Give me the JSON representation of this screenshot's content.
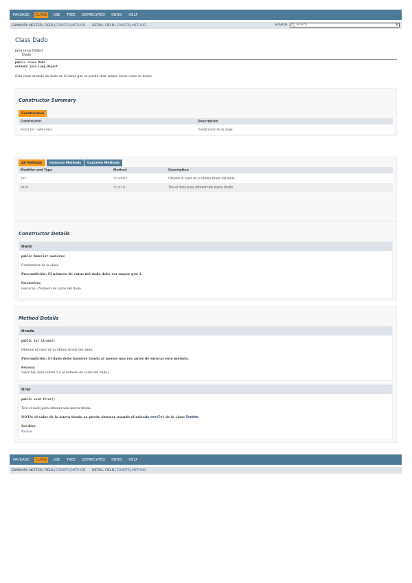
{
  "nav": {
    "items": [
      "PACKAGE",
      "CLASS",
      "USE",
      "TREE",
      "DEPRECATED",
      "INDEX",
      "HELP"
    ],
    "active_index": 1
  },
  "subnav": {
    "summary_label": "SUMMARY:",
    "summary_nested": "NESTED",
    "summary_field": "FIELD",
    "summary_constr": "CONSTR",
    "summary_method": "METHOD",
    "detail_label": "DETAIL:",
    "detail_field": "FIELD",
    "detail_constr": "CONSTR",
    "detail_method": "METHOD",
    "sep": "|"
  },
  "search": {
    "label": "SEARCH:",
    "placeholder": "Search",
    "clear": "X"
  },
  "header": {
    "title": "Class Dado",
    "inherit_parent": "java.lang.Object",
    "inherit_child": "Dado",
    "sig_line1": "public class Dado",
    "sig_line2": "extends java.lang.Object",
    "description": "Esta clase modela un dado de N caras que se puede tirar tantas veces como se desee."
  },
  "constructor_summary": {
    "title": "Constructor Summary",
    "caption": "Constructors",
    "col_constructor": "Constructor",
    "col_description": "Description",
    "rows": [
      {
        "name": "Dado",
        "params": "(int numCaras)",
        "description": "Constructor de la clase."
      }
    ]
  },
  "method_summary": {
    "tabs": [
      "All Methods",
      "Instance Methods",
      "Concrete Methods"
    ],
    "active_tab": 0,
    "col_modifier": "Modifier and Type",
    "col_method": "Method",
    "col_description": "Description",
    "rows": [
      {
        "modifier": "int",
        "method": "tirada",
        "params": "()",
        "description": "Obtiene el valor de la última tirada del dado."
      },
      {
        "modifier": "void",
        "method": "tirar",
        "params": "()",
        "description": "Tira el dado para obtener una nueva tirada."
      }
    ]
  },
  "constructor_details": {
    "title": "Constructor Details",
    "name": "Dado",
    "signature": "public Dado(int numCaras)",
    "text": "Constructor de la clase.",
    "precondition": "Precondición: El número de caras del dado debe ser mayor que 1.",
    "params_label": "Parameters:",
    "param_name": "numCaras",
    "param_desc": " - Número de caras del dado."
  },
  "method_details": {
    "title": "Method Details",
    "tirada": {
      "name": "tirada",
      "signature": "public int tirada()",
      "text": "Obtiene el valor de la última tirada del dado.",
      "precondition": "Precondición: El dado debe haberse tirado al menos una vez antes de invocar este método.",
      "returns_label": "Returns:",
      "returns_text": "Valor del dado (entre 1 y el número de caras del dado)."
    },
    "tirar": {
      "name": "tirar",
      "signature": "public void tirar()",
      "text": "Tira el dado para obtener una nueva tirada.",
      "note_prefix": "NOTA: el valor de la nueva tirada se puede obtener usando el método ",
      "note_link1": "nextInt",
      "note_middle": " de la clase ",
      "note_link2": "Random",
      "note_suffix": ".",
      "see_label": "See Also:",
      "see_link": "Random"
    }
  }
}
